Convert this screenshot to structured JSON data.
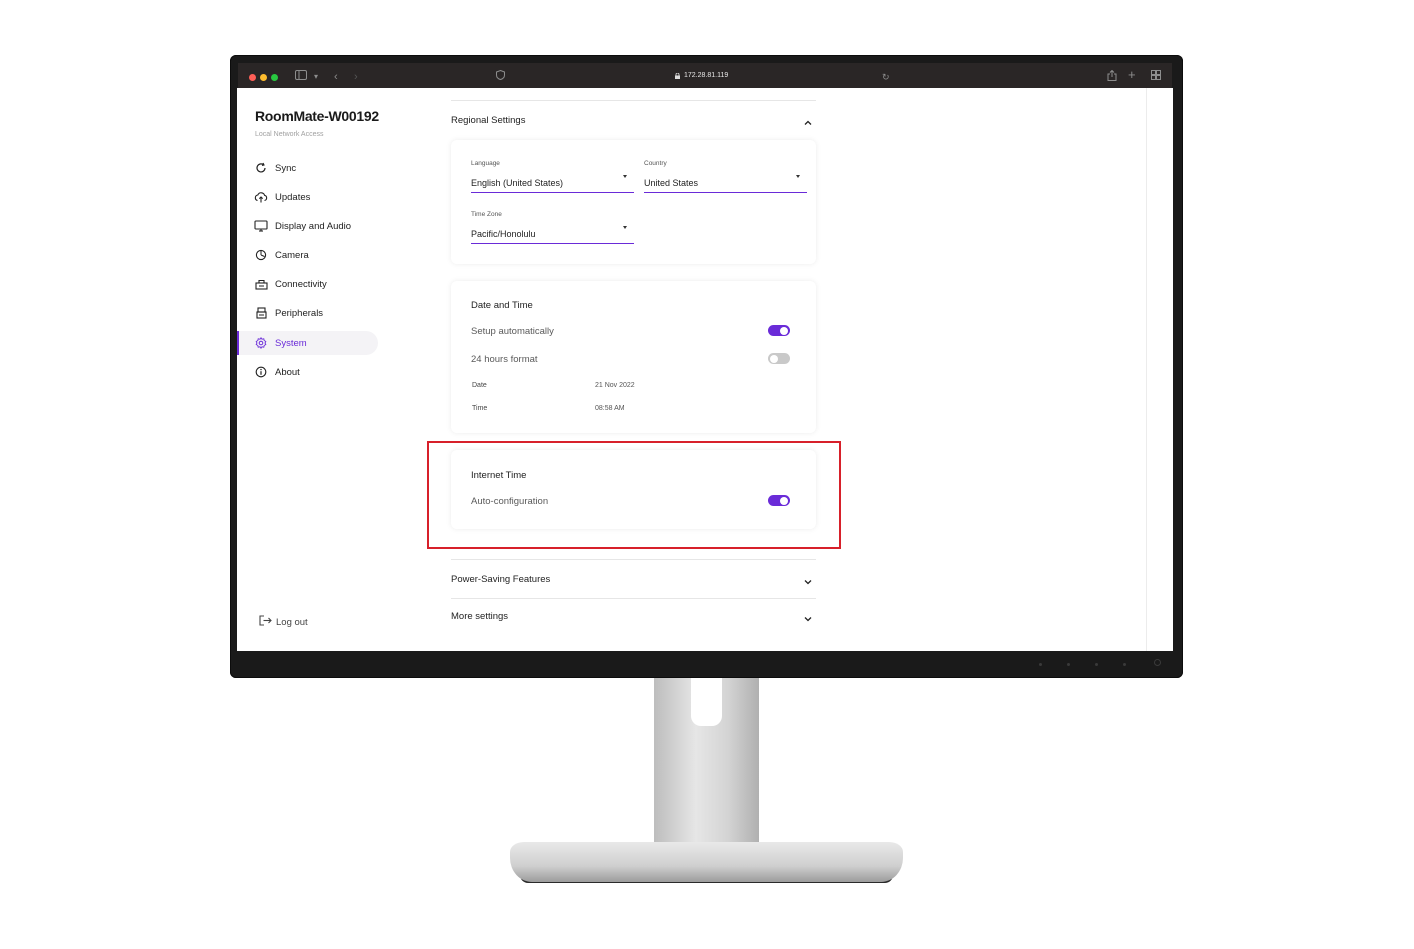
{
  "browser": {
    "url": "172.28.81.119"
  },
  "sidebar": {
    "device_name": "RoomMate-W00192",
    "subtitle": "Local Network Access",
    "items": [
      {
        "label": "Sync",
        "icon": "sync-icon"
      },
      {
        "label": "Updates",
        "icon": "cloud-upload-icon"
      },
      {
        "label": "Display and Audio",
        "icon": "monitor-icon"
      },
      {
        "label": "Camera",
        "icon": "camera-icon"
      },
      {
        "label": "Connectivity",
        "icon": "network-icon"
      },
      {
        "label": "Peripherals",
        "icon": "peripheral-icon"
      },
      {
        "label": "System",
        "icon": "gear-icon",
        "active": true
      },
      {
        "label": "About",
        "icon": "info-icon"
      }
    ],
    "logout_label": "Log out"
  },
  "regional": {
    "title": "Regional Settings",
    "language_label": "Language",
    "language_value": "English (United States)",
    "country_label": "Country",
    "country_value": "United States",
    "timezone_label": "Time Zone",
    "timezone_value": "Pacific/Honolulu"
  },
  "datetime": {
    "title": "Date and Time",
    "setup_auto_label": "Setup automatically",
    "setup_auto_on": true,
    "format24_label": "24 hours format",
    "format24_on": false,
    "date_label": "Date",
    "date_value": "21 Nov 2022",
    "time_label": "Time",
    "time_value": "08:58 AM"
  },
  "internet_time": {
    "title": "Internet Time",
    "auto_config_label": "Auto-configuration",
    "auto_config_on": true
  },
  "sections": {
    "power_saving": "Power-Saving Features",
    "more_settings": "More settings"
  },
  "colors": {
    "accent": "#6a2bd8",
    "highlight": "#d7202a"
  }
}
